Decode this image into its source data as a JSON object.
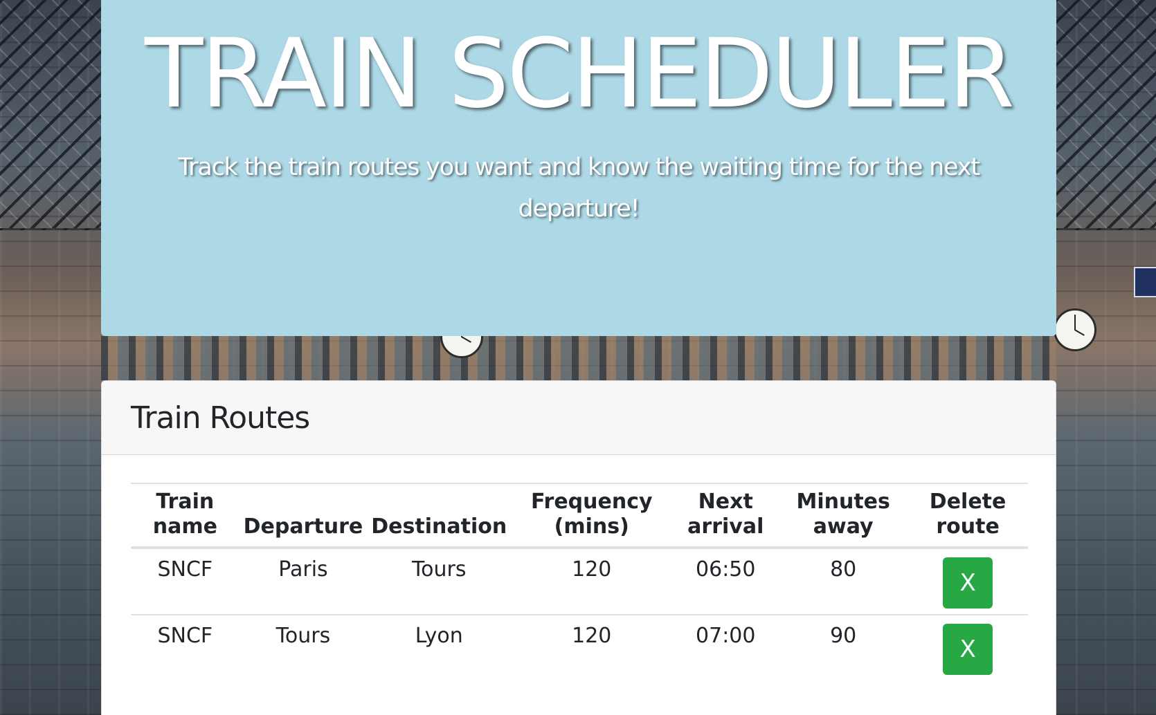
{
  "jumbotron": {
    "title": "TRAIN SCHEDULER",
    "subtitle": "Track the train routes you want and know the waiting time for the next departure!"
  },
  "card": {
    "title": "Train Routes"
  },
  "table": {
    "headers": [
      "Train name",
      "Departure",
      "Destination",
      "Frequency (mins)",
      "Next arrival",
      "Minutes away",
      "Delete route"
    ],
    "rows": [
      {
        "train": "SNCF",
        "departure": "Paris",
        "destination": "Tours",
        "frequency": "120",
        "next_arrival": "06:50",
        "minutes_away": "80",
        "delete_label": "X"
      },
      {
        "train": "SNCF",
        "departure": "Tours",
        "destination": "Lyon",
        "frequency": "120",
        "next_arrival": "07:00",
        "minutes_away": "90",
        "delete_label": "X"
      }
    ]
  },
  "colors": {
    "jumbotron_bg": "#add8e6",
    "delete_button": "#28a745"
  }
}
